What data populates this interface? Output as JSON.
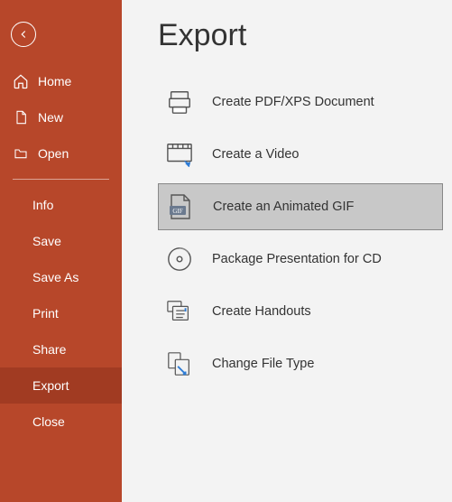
{
  "sidebar": {
    "primary": [
      {
        "id": "home",
        "label": "Home",
        "icon": "home"
      },
      {
        "id": "new",
        "label": "New",
        "icon": "file"
      },
      {
        "id": "open",
        "label": "Open",
        "icon": "folder"
      }
    ],
    "secondary": [
      {
        "id": "info",
        "label": "Info"
      },
      {
        "id": "save",
        "label": "Save"
      },
      {
        "id": "saveas",
        "label": "Save As"
      },
      {
        "id": "print",
        "label": "Print"
      },
      {
        "id": "share",
        "label": "Share"
      },
      {
        "id": "export",
        "label": "Export",
        "selected": true
      },
      {
        "id": "close",
        "label": "Close"
      }
    ]
  },
  "page": {
    "title": "Export"
  },
  "export": {
    "options": [
      {
        "id": "pdfxps",
        "label": "Create PDF/XPS Document",
        "icon": "pdf"
      },
      {
        "id": "video",
        "label": "Create a Video",
        "icon": "video"
      },
      {
        "id": "gif",
        "label": "Create an Animated GIF",
        "icon": "gif",
        "selected": true
      },
      {
        "id": "packagecd",
        "label": "Package Presentation for CD",
        "icon": "cd"
      },
      {
        "id": "handouts",
        "label": "Create Handouts",
        "icon": "handouts"
      },
      {
        "id": "changetype",
        "label": "Change File Type",
        "icon": "changetype"
      }
    ]
  }
}
